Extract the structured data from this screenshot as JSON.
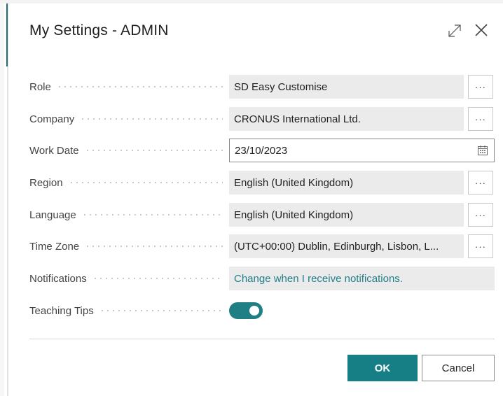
{
  "dialog": {
    "title": "My Settings - ADMIN",
    "expand_icon": "expand-icon",
    "close_icon": "close-icon"
  },
  "fields": {
    "role": {
      "label": "Role",
      "value": "SD Easy Customise",
      "more": "···"
    },
    "company": {
      "label": "Company",
      "value": "CRONUS International Ltd.",
      "more": "···"
    },
    "work_date": {
      "label": "Work Date",
      "value": "23/10/2023",
      "icon": "calendar-icon"
    },
    "region": {
      "label": "Region",
      "value": "English (United Kingdom)",
      "more": "···"
    },
    "language": {
      "label": "Language",
      "value": "English (United Kingdom)",
      "more": "···"
    },
    "time_zone": {
      "label": "Time Zone",
      "value": "(UTC+00:00) Dublin, Edinburgh, Lisbon, L...",
      "more": "···"
    },
    "notifications": {
      "label": "Notifications",
      "value": "Change when I receive notifications."
    },
    "teaching_tips": {
      "label": "Teaching Tips",
      "enabled": true
    }
  },
  "footer": {
    "ok_label": "OK",
    "cancel_label": "Cancel"
  },
  "colors": {
    "accent": "#167f86",
    "link": "#217f89",
    "field_bg": "#ebebeb"
  }
}
